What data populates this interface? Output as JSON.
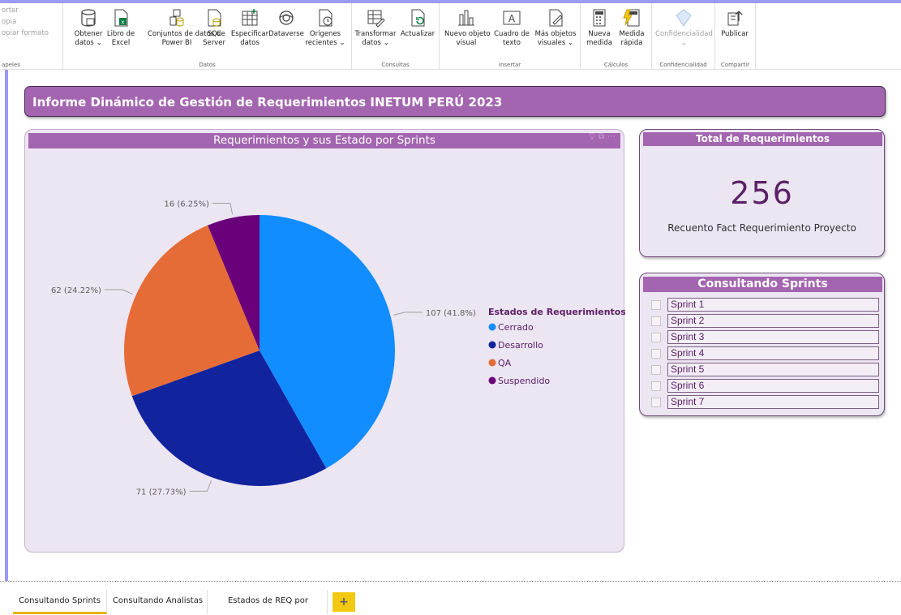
{
  "ribbon": {
    "clipboard": {
      "items": [
        "ortar",
        "opia",
        "opiar formato"
      ],
      "group_label": "apeles"
    },
    "groups": [
      {
        "label": "Datos",
        "buttons": [
          {
            "line1": "Obtener",
            "line2": "datos ⌄",
            "icon": "database-icon"
          },
          {
            "line1": "Libro de",
            "line2": "Excel",
            "icon": "excel-icon"
          },
          {
            "line1": "Conjuntos de datos de",
            "line2": "Power BI",
            "icon": "dataset-icon"
          },
          {
            "line1": "SQL",
            "line2": "Server",
            "icon": "sql-server-icon"
          },
          {
            "line1": "Especificar",
            "line2": "datos",
            "icon": "table-icon"
          },
          {
            "line1": "Dataverse",
            "line2": "",
            "icon": "dataverse-icon"
          },
          {
            "line1": "Orígenes",
            "line2": "recientes ⌄",
            "icon": "recent-sources-icon"
          }
        ]
      },
      {
        "label": "Consultas",
        "buttons": [
          {
            "line1": "Transformar",
            "line2": "datos ⌄",
            "icon": "transform-icon"
          },
          {
            "line1": "Actualizar",
            "line2": "",
            "icon": "refresh-icon"
          }
        ]
      },
      {
        "label": "Insertar",
        "buttons": [
          {
            "line1": "Nuevo objeto",
            "line2": "visual",
            "icon": "new-visual-icon"
          },
          {
            "line1": "Cuadro de",
            "line2": "texto",
            "icon": "textbox-icon"
          },
          {
            "line1": "Más objetos",
            "line2": "visuales ⌄",
            "icon": "more-visuals-icon"
          }
        ]
      },
      {
        "label": "Cálculos",
        "buttons": [
          {
            "line1": "Nueva",
            "line2": "medida",
            "icon": "calculator-icon"
          },
          {
            "line1": "Medida",
            "line2": "rápida",
            "icon": "quick-measure-icon"
          }
        ]
      },
      {
        "label": "Confidencialidad",
        "buttons": [
          {
            "line1": "Confidencialidad",
            "line2": "⌄",
            "icon": "sensitivity-icon",
            "disabled": true
          }
        ]
      },
      {
        "label": "Compartir",
        "buttons": [
          {
            "line1": "Publicar",
            "line2": "",
            "icon": "publish-icon"
          }
        ]
      }
    ]
  },
  "report": {
    "title": "Informe Dinámico de Gestión de Requerimientos INETUM PERÚ 2023"
  },
  "pie_visual": {
    "header": "Requerimientos y sus Estado por Sprints",
    "tool_icons": [
      "filter-icon",
      "focus-mode-icon",
      "more-options-icon"
    ]
  },
  "chart_data": {
    "type": "pie",
    "title": "Requerimientos y sus Estado por Sprints",
    "legend_title": "Estados de Requerimientos",
    "legend_position": "right",
    "slices": [
      {
        "name": "Cerrado",
        "value": 107,
        "label": "107 (41.8%)",
        "color": "#118dff"
      },
      {
        "name": "Desarrollo",
        "value": 71,
        "label": "71 (27.73%)",
        "color": "#12239e"
      },
      {
        "name": "QA",
        "value": 62,
        "label": "62 (24.22%)",
        "color": "#e66c37"
      },
      {
        "name": "Suspendido",
        "value": 16,
        "label": "16 (6.25%)",
        "color": "#6b007b"
      }
    ]
  },
  "total_card": {
    "header": "Total de Requerimientos",
    "value": "256",
    "caption": "Recuento Fact Requerimiento Proyecto"
  },
  "slicer": {
    "header": "Consultando Sprints",
    "items": [
      "Sprint 1",
      "Sprint 2",
      "Sprint 3",
      "Sprint 4",
      "Sprint 5",
      "Sprint 6",
      "Sprint 7"
    ]
  },
  "page_tabs": {
    "tabs": [
      "Consultando Sprints",
      "Consultando Analistas",
      "Estados de REQ por Analistas"
    ],
    "active": "Consultando Sprints",
    "add_label": "+"
  },
  "colors": {
    "accent": "#a465b0",
    "card_bg": "#ece5f2",
    "value_color": "#5b2066",
    "tab_accent": "#f2c811"
  }
}
